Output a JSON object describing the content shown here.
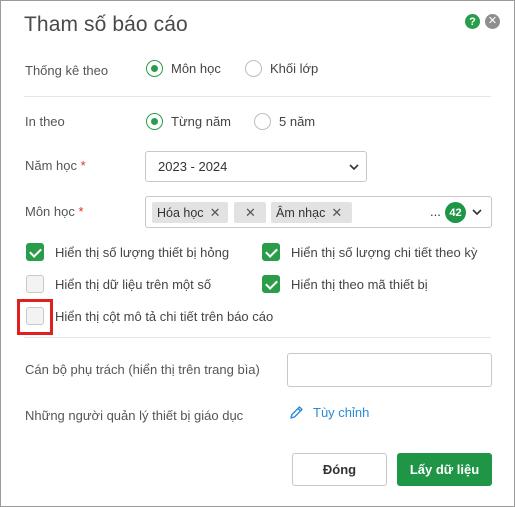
{
  "dialog": {
    "title": "Tham số báo cáo",
    "help_icon": "?",
    "close_icon": "✕"
  },
  "stats_by": {
    "label": "Thống kê theo",
    "options": [
      {
        "label": "Môn học",
        "selected": true
      },
      {
        "label": "Khối lớp",
        "selected": false
      }
    ]
  },
  "print_by": {
    "label": "In theo",
    "options": [
      {
        "label": "Từng năm",
        "selected": true
      },
      {
        "label": "5 năm",
        "selected": false
      }
    ]
  },
  "school_year": {
    "label": "Năm học",
    "required_mark": "*",
    "value": "2023 - 2024"
  },
  "subject": {
    "label": "Môn học",
    "required_mark": "*",
    "tags": [
      "Hóa học",
      "",
      "Âm nhạc"
    ],
    "more": "...",
    "count": "42"
  },
  "checkboxes": [
    {
      "label": "Hiển thị số lượng thiết bị hỏng",
      "checked": true
    },
    {
      "label": "Hiển thị số lượng chi tiết theo kỳ",
      "checked": true
    },
    {
      "label": "Hiển thị dữ liệu trên một số",
      "checked": false
    },
    {
      "label": "Hiển thị theo mã thiết bị",
      "checked": true
    },
    {
      "label": "Hiển thị cột mô tả chi tiết trên báo cáo",
      "checked": false
    }
  ],
  "staff": {
    "label": "Cán bộ phụ trách (hiển thị trên trang bìa)",
    "value": ""
  },
  "managers": {
    "label": "Những người quản lý thiết bị giáo dục",
    "action_label": "Tùy chỉnh"
  },
  "footer": {
    "close_label": "Đóng",
    "submit_label": "Lấy dữ liệu"
  },
  "colors": {
    "accent": "#2a9d4a",
    "primary_button": "#1f9646",
    "link": "#2a8bd8",
    "required": "#e0321e",
    "highlight": "#e01f1f"
  }
}
